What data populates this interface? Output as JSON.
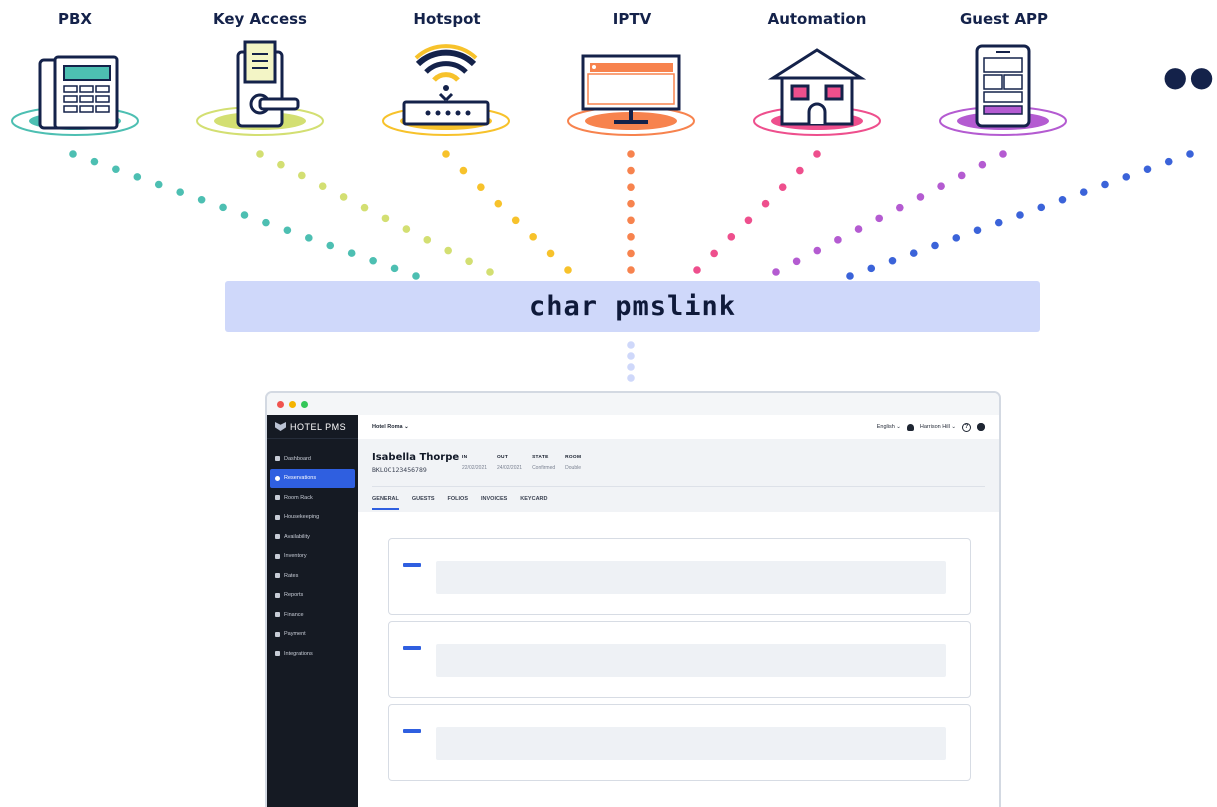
{
  "integrations": [
    {
      "label": "PBX",
      "icon": "phone-icon",
      "color": "#4dbfb2"
    },
    {
      "label": "Key Access",
      "icon": "door-lock-icon",
      "color": "#d3df72"
    },
    {
      "label": "Hotspot",
      "icon": "wifi-router-icon",
      "color": "#f7c22b"
    },
    {
      "label": "IPTV",
      "icon": "tv-icon",
      "color": "#f7834e"
    },
    {
      "label": "Automation",
      "icon": "house-icon",
      "color": "#ee4f8d"
    },
    {
      "label": "Guest APP",
      "icon": "smartphone-icon",
      "color": "#b45bd1"
    },
    {
      "label": "",
      "icon": "more-dots-icon",
      "color": "#3b63d9"
    }
  ],
  "hub": {
    "label": "char pmslink",
    "color": "#cfd8fa"
  },
  "pms": {
    "brand": "HOTEL PMS",
    "hotel": "Hotel Roma",
    "language": "English",
    "user": "Harrison Hill",
    "nav": [
      "Dashboard",
      "Reservations",
      "Room Rack",
      "Housekeeping",
      "Availability",
      "Inventory",
      "Rates",
      "Reports",
      "Finance",
      "Payment",
      "Integrations"
    ],
    "active_nav": "Reservations",
    "guest": {
      "name": "Isabella Thorpe",
      "booking": "BKLOC123456789"
    },
    "meta": {
      "in_label": "IN",
      "in_value": "22/02/2021",
      "out_label": "OUT",
      "out_value": "24/02/2021",
      "state_label": "STATE",
      "state_value": "Confirmed",
      "room_label": "ROOM",
      "room_value": "Double"
    },
    "tabs": [
      "GENERAL",
      "GUESTS",
      "FOLIOS",
      "INVOICES",
      "KEYCARD"
    ],
    "active_tab": "GENERAL",
    "accent": "#2f5fe0"
  }
}
